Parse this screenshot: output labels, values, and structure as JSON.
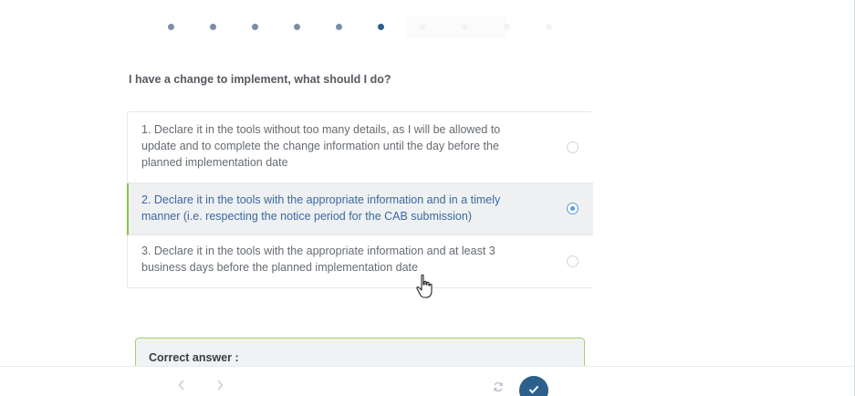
{
  "progress": {
    "total": 10,
    "current_index": 5
  },
  "question": {
    "text": "I have a change to implement, what should I do?"
  },
  "options": [
    {
      "text": "1. Declare it in the tools without too many details, as I will be allowed to update and to complete the change information until the day before the planned implementation date",
      "selected": false
    },
    {
      "text": "2. Declare it in the tools with the appropriate information and in a timely manner (i.e. respecting the notice period for the CAB submission)",
      "selected": true
    },
    {
      "text": "3. Declare it in the tools with the appropriate information and at least 3 business days before the planned implementation date",
      "selected": false
    }
  ],
  "answer": {
    "title": "Correct answer :"
  },
  "nav": {
    "prev_icon": "chevron-left-icon",
    "next_icon": "chevron-right-icon",
    "refresh_icon": "refresh-icon",
    "submit_icon": "check-icon"
  },
  "colors": {
    "accent": "#2d5f8b",
    "selected_text": "#3b6aa0",
    "selected_border": "#8bc34a",
    "answer_border": "#a6d26a"
  }
}
